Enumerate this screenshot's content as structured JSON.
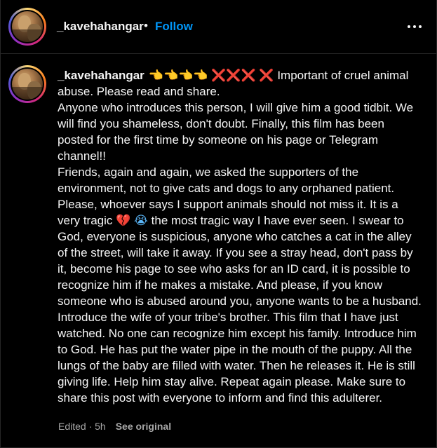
{
  "header": {
    "username": "_kavehahangar",
    "separator": "•",
    "follow_label": "Follow",
    "more_icon": "more-horizontal-icon"
  },
  "post": {
    "username": "_kavehahangar",
    "emoji_prefix": {
      "hands": "👈👈👈👈",
      "crosses": "❌❌❌ ❌"
    },
    "text_1": " Important of cruel animal abuse. Please read and share.",
    "text_2": "Anyone who introduces this person, I will give him a good tidbit. We will find you shameless, don't doubt. Finally, this film has been posted for the first time by someone on his page or Telegram channel!!",
    "text_3a": "Friends, again and again, we asked the supporters of the environment, not to give cats and dogs to any orphaned patient. Please, whoever says I support animals should not miss it. It is a very tragic ",
    "emoji_heart": "💔",
    "emoji_cry": "😭",
    "text_3b": " the most tragic way I have ever seen. I swear to God, everyone is suspicious, anyone who catches a cat in the alley of the street, will take it away. If you see a stray head, don't pass by it, become his page to see who asks for an ID card, it is possible to recognize him if he makes a mistake. And please, if you know someone who is abused around you, anyone wants to be a husband. Introduce the wife of your tribe's brother. This film that I have just watched. No one can recognize him except his family. Introduce him to God. He has put the water pipe in the mouth of the puppy. All the lungs of the baby are filled with water. Then he releases it. He is still giving life. Help him stay alive. Repeat again please. Make sure to share this post with everyone to inform and find this adulterer."
  },
  "meta": {
    "edited": "Edited · 5h",
    "see_original": "See original"
  },
  "colors": {
    "background": "#000000",
    "text": "#f5f5f5",
    "accent": "#0095f6",
    "muted": "#a8a8a8"
  }
}
